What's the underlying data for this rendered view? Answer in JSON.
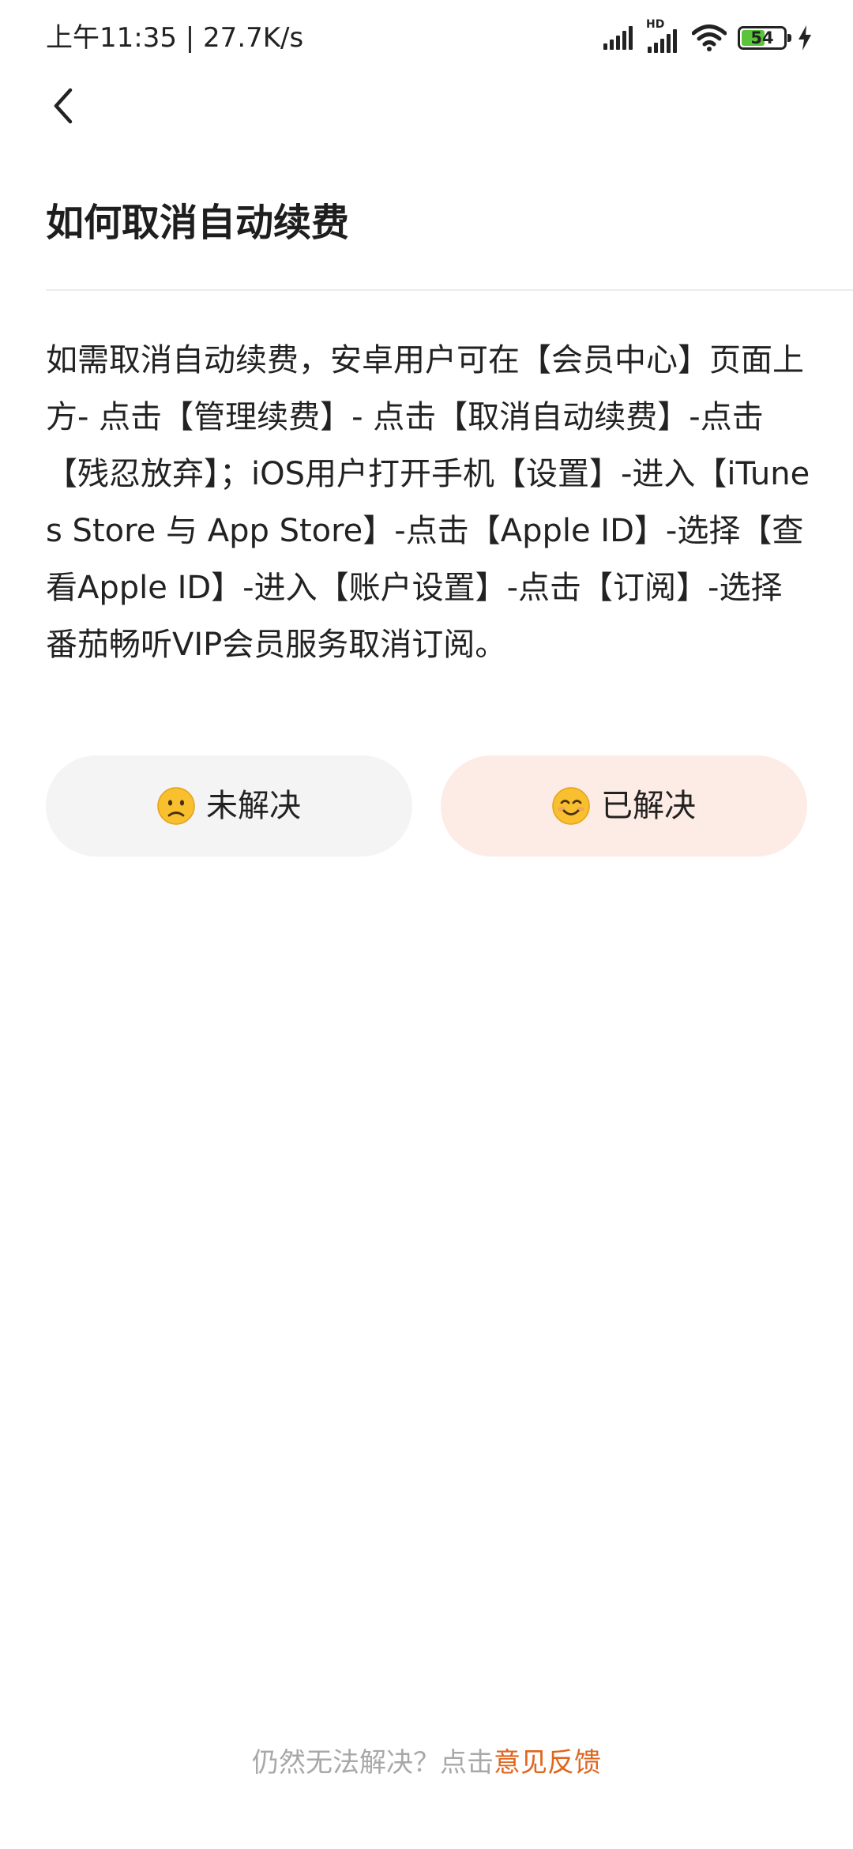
{
  "status_bar": {
    "time_speed": "上午11:35 | 27.7K/s",
    "network_badge": "HD",
    "battery_level": "54",
    "icons": [
      "signal-icon",
      "hd-signal-icon",
      "wifi-icon",
      "battery-icon",
      "charging-icon"
    ]
  },
  "nav": {
    "back_icon": "chevron-left-icon"
  },
  "article": {
    "title": "如何取消自动续费",
    "body": "如需取消自动续费，安卓用户可在【会员中心】页面上方- 点击【管理续费】- 点击【取消自动续费】-点击【残忍放弃】；iOS用户打开手机【设置】-进入【iTunes Store 与 App Store】-点击【Apple ID】-选择【查看Apple ID】-进入【账户设置】-点击【订阅】-选择番茄畅听VIP会员服务取消订阅。"
  },
  "feedback": {
    "unresolved_label": "未解决",
    "unresolved_icon": "frown-emoji-icon",
    "resolved_label": "已解决",
    "resolved_icon": "smile-emoji-icon"
  },
  "footer": {
    "prompt": "仍然无法解决？点击",
    "link": "意见反馈"
  },
  "colors": {
    "accent": "#e0661f",
    "resolved_bg": "#fdece5",
    "unresolved_bg": "#f4f4f4",
    "battery_green": "#5ac43a"
  }
}
